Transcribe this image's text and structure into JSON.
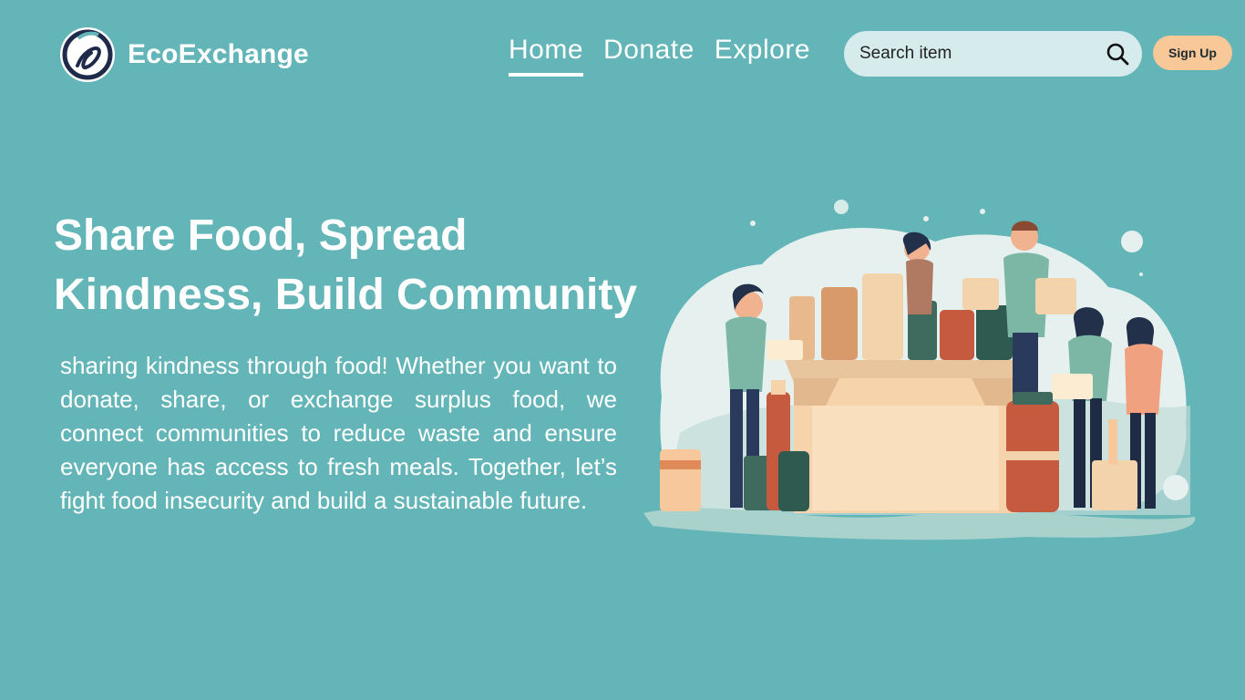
{
  "brand": {
    "name": "EcoExchange",
    "logo_icon": "swirl-leaf-icon"
  },
  "nav": {
    "items": [
      {
        "label": "Home",
        "active": true
      },
      {
        "label": "Donate",
        "active": false
      },
      {
        "label": "Explore",
        "active": false
      }
    ]
  },
  "search": {
    "placeholder": "Search item",
    "value": "",
    "icon": "search-icon"
  },
  "signup": {
    "label": "Sign Up"
  },
  "hero": {
    "title_line1": "Share Food, Spread",
    "title_line2": "Kindness, Build Community",
    "description": "sharing kindness through food! Whether you want to donate, share, or exchange surplus food, we connect communities to reduce waste and ensure everyone has access to fresh meals. Together, let’s fight food insecurity and build a sustainable future."
  },
  "colors": {
    "background": "#63b5b7",
    "search_bg": "#d6ebeb",
    "signup_bg": "#f8c898",
    "text": "#ffffff",
    "logo_ring": "#1f2a4a"
  }
}
